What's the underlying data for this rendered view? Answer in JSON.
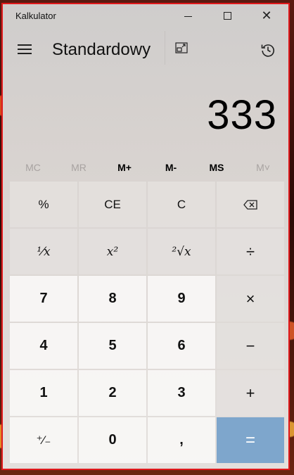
{
  "window": {
    "title": "Kalkulator"
  },
  "header": {
    "mode": "Standardowy"
  },
  "display": {
    "value": "333"
  },
  "memory": [
    {
      "label": "MC",
      "enabled": false
    },
    {
      "label": "MR",
      "enabled": false
    },
    {
      "label": "M+",
      "enabled": true
    },
    {
      "label": "M-",
      "enabled": true
    },
    {
      "label": "MS",
      "enabled": true
    },
    {
      "label": "M˅",
      "enabled": false
    }
  ],
  "keys": {
    "percent": "%",
    "ce": "CE",
    "c": "C",
    "reciprocal": "¹⁄x",
    "square": "x²",
    "sqrt": "²√x",
    "divide": "÷",
    "multiply": "×",
    "minus": "−",
    "plus": "+",
    "negate": "⁺⁄₋",
    "decimal": ",",
    "equals": "=",
    "n0": "0",
    "n1": "1",
    "n2": "2",
    "n3": "3",
    "n4": "4",
    "n5": "5",
    "n6": "6",
    "n7": "7",
    "n8": "8",
    "n9": "9"
  },
  "icons": {
    "menu": "hamburger-icon",
    "compact_overlay": "compact-overlay-icon",
    "history": "history-icon",
    "backspace": "backspace-icon"
  }
}
